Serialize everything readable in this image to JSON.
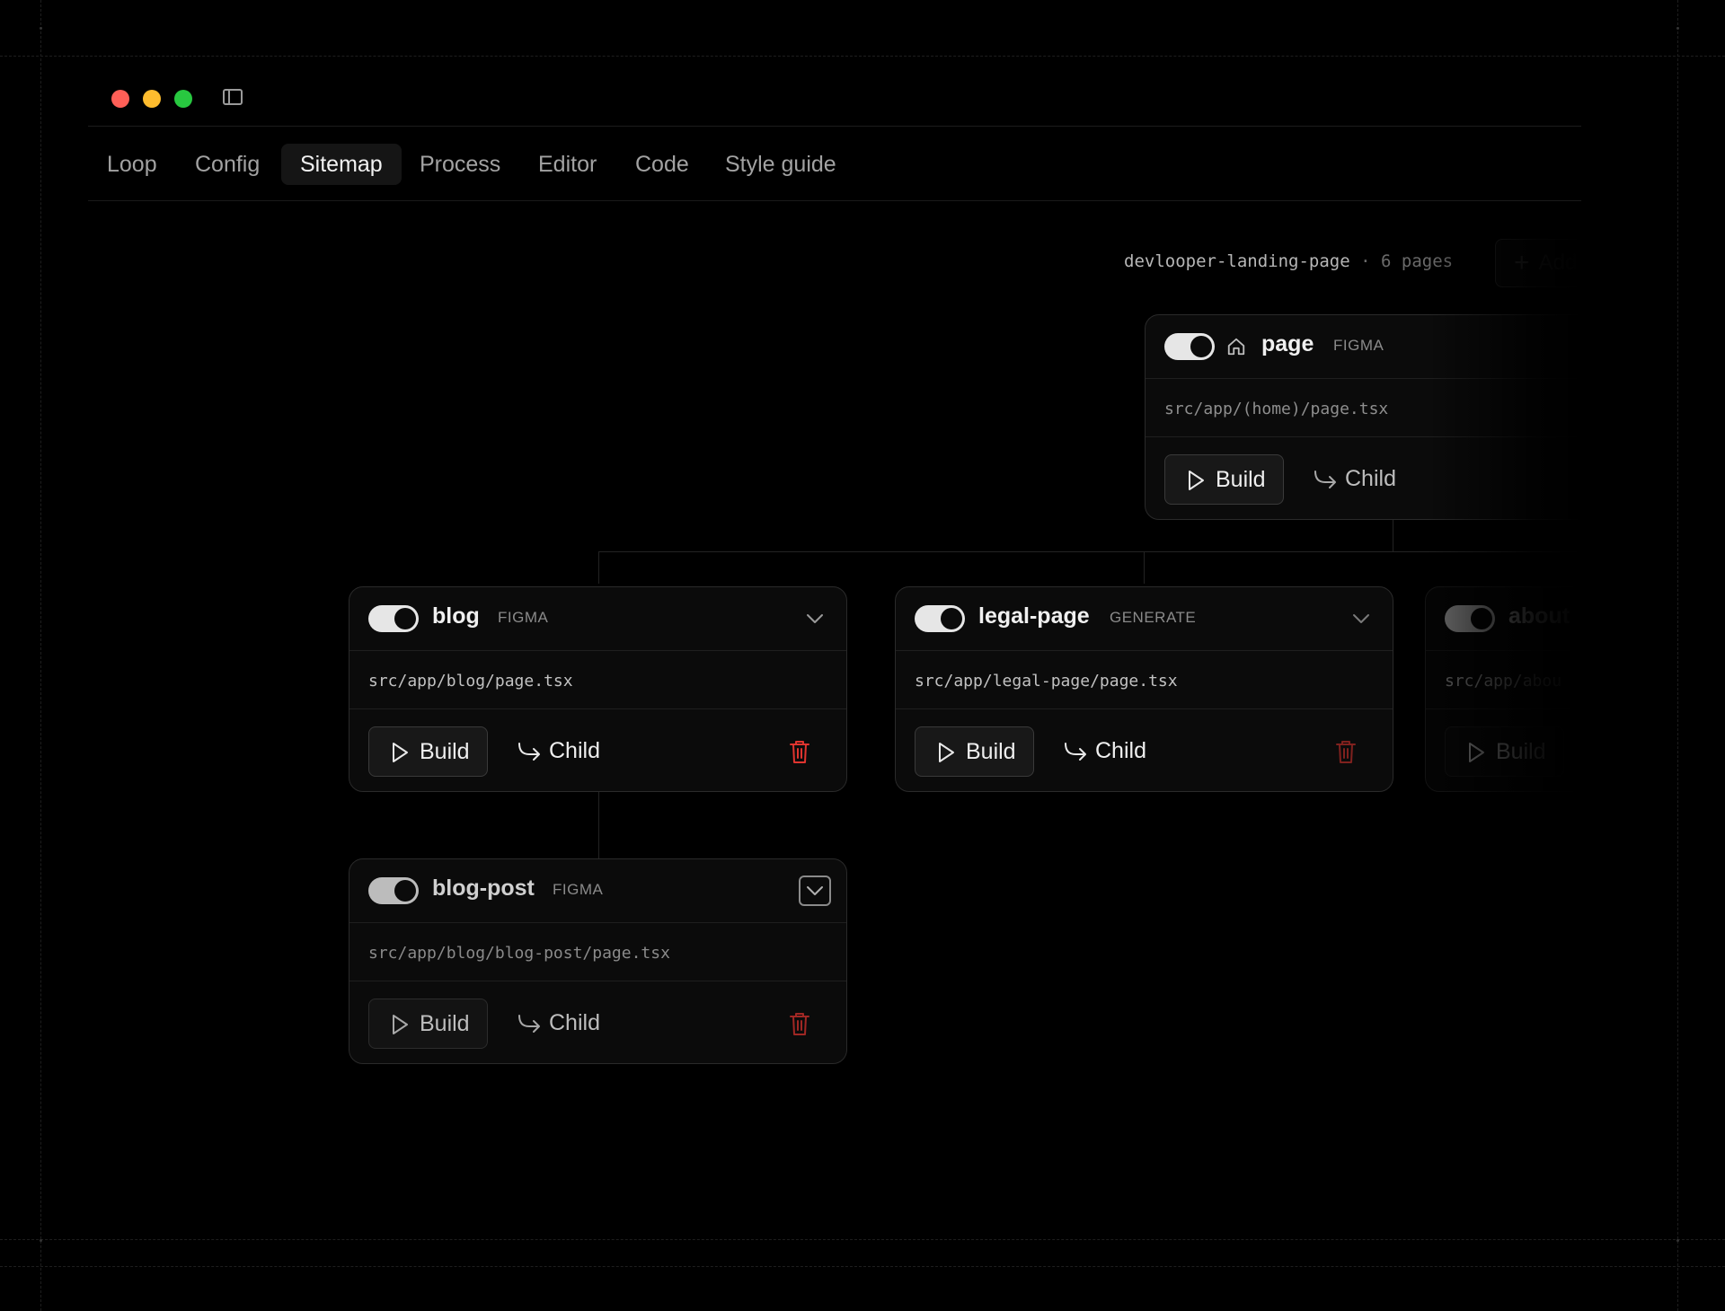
{
  "window": {
    "traffic_lights": {
      "close_color": "#ff5f57",
      "minimize_color": "#febc2e",
      "maximize_color": "#28c840"
    },
    "sidebar_toggle_icon": "sidebar-panel-icon"
  },
  "tabs": [
    {
      "label": "Loop",
      "active": false
    },
    {
      "label": "Config",
      "active": false
    },
    {
      "label": "Sitemap",
      "active": true
    },
    {
      "label": "Process",
      "active": false
    },
    {
      "label": "Editor",
      "active": false
    },
    {
      "label": "Code",
      "active": false
    },
    {
      "label": "Style guide",
      "active": false
    }
  ],
  "sitemap": {
    "project": "devlooper-landing-page",
    "separator": "·",
    "page_count": "6 pages",
    "add_label": "Add",
    "add_icon": "plus-icon"
  },
  "cards": [
    {
      "name": "page",
      "badge": "FIGMA",
      "path": "src/app/(home)/page.tsx",
      "enabled": true,
      "is_home": true,
      "build_label": "Build",
      "child_label": "Child"
    },
    {
      "name": "blog",
      "badge": "FIGMA",
      "path": "src/app/blog/page.tsx",
      "enabled": true,
      "build_label": "Build",
      "child_label": "Child"
    },
    {
      "name": "legal-page",
      "badge": "GENERATE",
      "path": "src/app/legal-page/page.tsx",
      "enabled": true,
      "build_label": "Build",
      "child_label": "Child"
    },
    {
      "name": "about",
      "badge": "",
      "path": "src/app/abou",
      "enabled": true,
      "build_label": "Build",
      "child_label": ""
    },
    {
      "name": "blog-post",
      "badge": "FIGMA",
      "path": "src/app/blog/blog-post/page.tsx",
      "enabled": true,
      "build_label": "Build",
      "child_label": "Child"
    }
  ],
  "colors": {
    "background": "#000000",
    "card_bg": "#0b0b0b",
    "delete_red": "#e0342f",
    "toggle_on": "#e6e6e6"
  }
}
